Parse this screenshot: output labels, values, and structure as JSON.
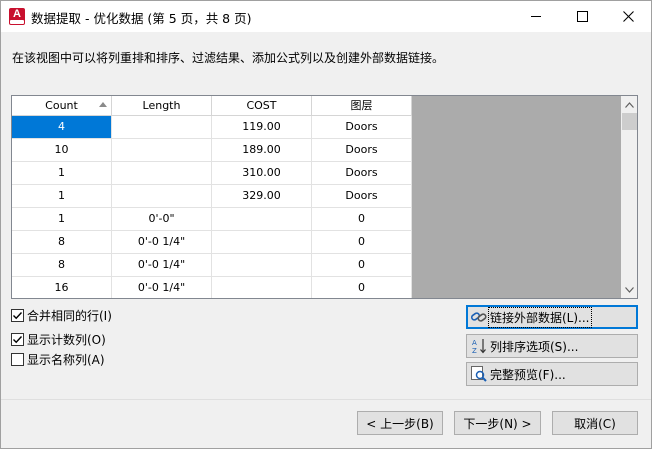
{
  "window": {
    "title": "数据提取 - 优化数据 (第 5 页，共 8 页)",
    "app_icon_letter": "A",
    "icons": {
      "app": "autocad-app-icon",
      "minimize": "minimize-icon",
      "maximize": "maximize-icon",
      "close": "close-icon"
    }
  },
  "description": "在该视图中可以将列重排和排序、过滤结果、添加公式列以及创建外部数据链接。",
  "grid": {
    "columns": [
      "Count",
      "Length",
      "COST",
      "图层"
    ],
    "sorted_column": "Count",
    "selected_cell": {
      "row": 0,
      "column": "Count"
    },
    "rows": [
      {
        "count": "4",
        "length": "",
        "cost": "119.00",
        "layer": "Doors"
      },
      {
        "count": "10",
        "length": "",
        "cost": "189.00",
        "layer": "Doors"
      },
      {
        "count": "1",
        "length": "",
        "cost": "310.00",
        "layer": "Doors"
      },
      {
        "count": "1",
        "length": "",
        "cost": "329.00",
        "layer": "Doors"
      },
      {
        "count": "1",
        "length": "0'-0\"",
        "cost": "",
        "layer": "0"
      },
      {
        "count": "8",
        "length": "0'-0 1/4\"",
        "cost": "",
        "layer": "0"
      },
      {
        "count": "8",
        "length": "0'-0 1/4\"",
        "cost": "",
        "layer": "0"
      },
      {
        "count": "16",
        "length": "0'-0 1/4\"",
        "cost": "",
        "layer": "0"
      }
    ]
  },
  "options": [
    {
      "label": "合并相同的行(I)",
      "checked": true
    },
    {
      "label": "显示计数列(O)",
      "checked": true
    },
    {
      "label": "显示名称列(A)",
      "checked": false
    }
  ],
  "side_buttons": {
    "link": "链接外部数据(L)...",
    "sort": "列排序选项(S)...",
    "preview": "完整预览(F)..."
  },
  "nav_buttons": {
    "back": "< 上一步(B)",
    "next": "下一步(N) >",
    "cancel": "取消(C)"
  },
  "colors": {
    "selection": "#0078d7",
    "empty_area": "#ababab",
    "accent": "#0078d7"
  }
}
